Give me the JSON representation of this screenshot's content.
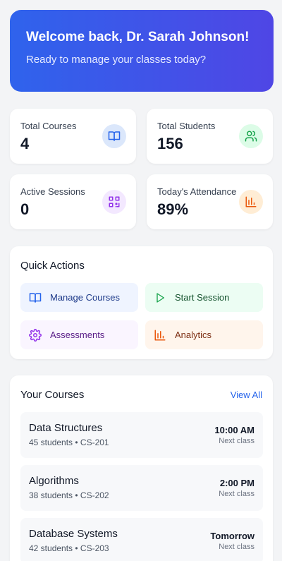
{
  "header": {
    "greeting": "Welcome back, Dr. Sarah Johnson!",
    "subtitle": "Ready to manage your classes today?"
  },
  "stats": [
    {
      "label": "Total Courses",
      "value": "4",
      "icon": "book-icon",
      "color": "#2563eb"
    },
    {
      "label": "Total Students",
      "value": "156",
      "icon": "users-icon",
      "color": "#16a34a"
    },
    {
      "label": "Active Sessions",
      "value": "0",
      "icon": "qr-code-icon",
      "color": "#9333ea"
    },
    {
      "label": "Today's Attendance",
      "value": "89%",
      "icon": "bar-chart-icon",
      "color": "#ea580c"
    }
  ],
  "quick_actions": {
    "title": "Quick Actions",
    "items": [
      {
        "label": "Manage Courses",
        "icon": "book-icon",
        "color": "#1e40af"
      },
      {
        "label": "Start Session",
        "icon": "play-icon",
        "color": "#166534"
      },
      {
        "label": "Assessments",
        "icon": "gear-icon",
        "color": "#6b21a8"
      },
      {
        "label": "Analytics",
        "icon": "bar-chart-icon",
        "color": "#9a3412"
      }
    ]
  },
  "courses": {
    "title": "Your Courses",
    "view_all": "View All",
    "next_label": "Next class",
    "items": [
      {
        "name": "Data Structures",
        "meta": "45 students • CS-201",
        "time": "10:00 AM",
        "next": "Next class"
      },
      {
        "name": "Algorithms",
        "meta": "38 students • CS-202",
        "time": "2:00 PM",
        "next": "Next class"
      },
      {
        "name": "Database Systems",
        "meta": "42 students • CS-203",
        "time": "Tomorrow",
        "next": "Next class"
      }
    ]
  }
}
